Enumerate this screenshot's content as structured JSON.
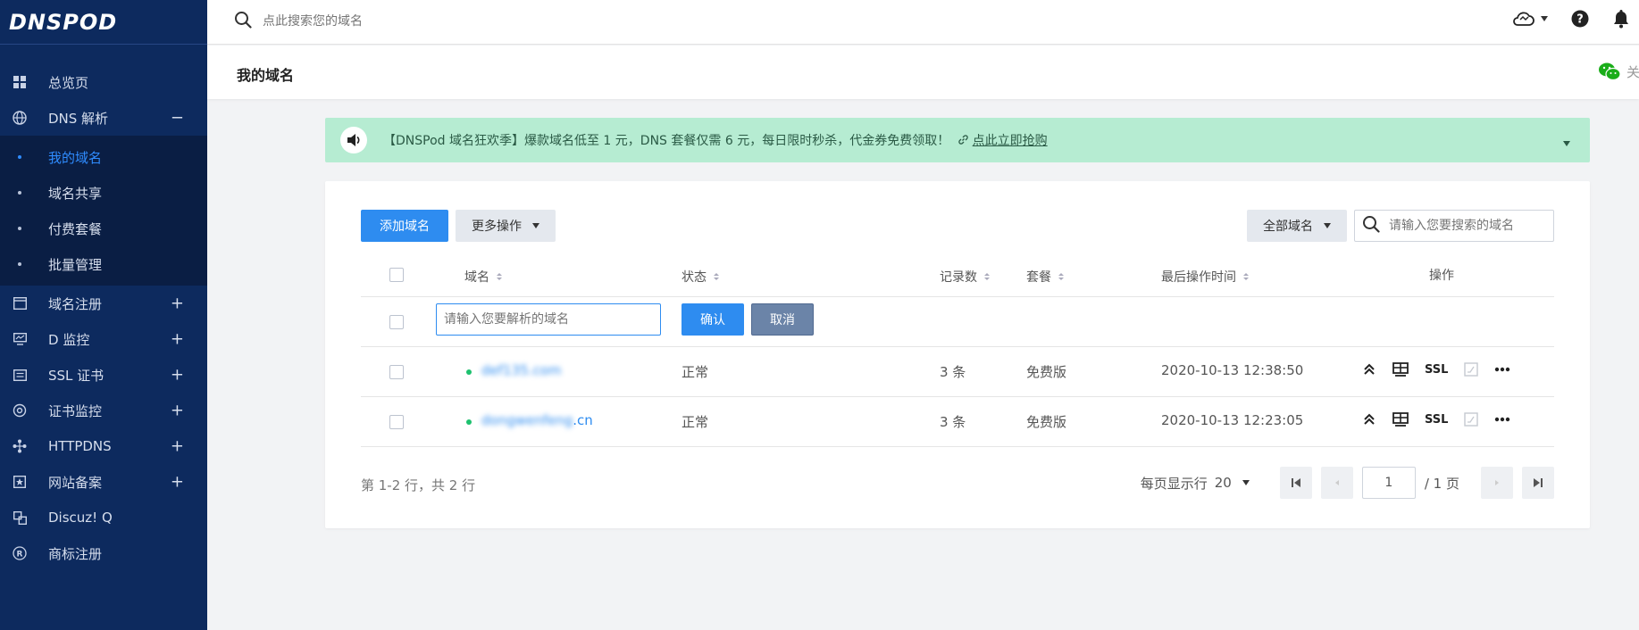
{
  "app": {
    "logo_text": "DNSPOD"
  },
  "sidebar": {
    "items": [
      {
        "label": "总览页",
        "icon": "grid-icon"
      },
      {
        "label": "DNS 解析",
        "icon": "globe-icon",
        "expand": "−"
      },
      {
        "label": "域名注册",
        "icon": "calendar-icon",
        "expand": "+"
      },
      {
        "label": "D 监控",
        "icon": "monitor-icon",
        "expand": "+"
      },
      {
        "label": "SSL 证书",
        "icon": "certificate-icon",
        "expand": "+"
      },
      {
        "label": "证书监控",
        "icon": "cert-monitor-icon",
        "expand": "+"
      },
      {
        "label": "HTTPDNS",
        "icon": "network-icon",
        "expand": "+"
      },
      {
        "label": "网站备案",
        "icon": "record-icon",
        "expand": "+"
      },
      {
        "label": "Discuz! Q",
        "icon": "discuz-icon"
      },
      {
        "label": "商标注册",
        "icon": "registered-icon"
      }
    ],
    "dns_sub": [
      {
        "label": "我的域名",
        "active": true
      },
      {
        "label": "域名共享"
      },
      {
        "label": "付费套餐"
      },
      {
        "label": "批量管理"
      }
    ]
  },
  "topbar": {
    "search_placeholder": "点此搜索您的域名"
  },
  "page": {
    "title": "我的域名",
    "follow_label": "关注"
  },
  "banner": {
    "text": "【DNSPod 域名狂欢季】爆款域名低至 1 元，DNS 套餐仅需 6 元，每日限时秒杀，代金券免费领取！",
    "link_text": "点此立即抢购"
  },
  "toolbar": {
    "add_label": "添加域名",
    "more_label": "更多操作",
    "filter_label": "全部域名",
    "search_placeholder": "请输入您要搜索的域名"
  },
  "table": {
    "columns": {
      "domain": "域名",
      "status": "状态",
      "records": "记录数",
      "plan": "套餐",
      "last_op": "最后操作时间",
      "actions": "操作"
    },
    "add_row": {
      "placeholder": "请输入您要解析的域名",
      "confirm": "确认",
      "cancel": "取消"
    },
    "rows": [
      {
        "domain_blur": "def135",
        "domain_tail": ".com",
        "status": "正常",
        "records": "3 条",
        "plan": "免费版",
        "time": "2020-10-13 12:38:50",
        "ssl": "SSL"
      },
      {
        "domain_blur": "dongwenfeng",
        "domain_tail": ".cn",
        "status": "正常",
        "records": "3 条",
        "plan": "免费版",
        "time": "2020-10-13 12:23:05",
        "ssl": "SSL"
      }
    ]
  },
  "footer": {
    "info": "第 1-2 行，共 2 行",
    "per_page_label": "每页显示行",
    "per_page_value": "20",
    "page_value": "1",
    "total_pages": "/ 1 页"
  },
  "colors": {
    "sidebar_bg": "#0d2a5e",
    "primary": "#2e8cf0",
    "banner_bg": "#b6ecd2",
    "status_green": "#1ec16f"
  }
}
